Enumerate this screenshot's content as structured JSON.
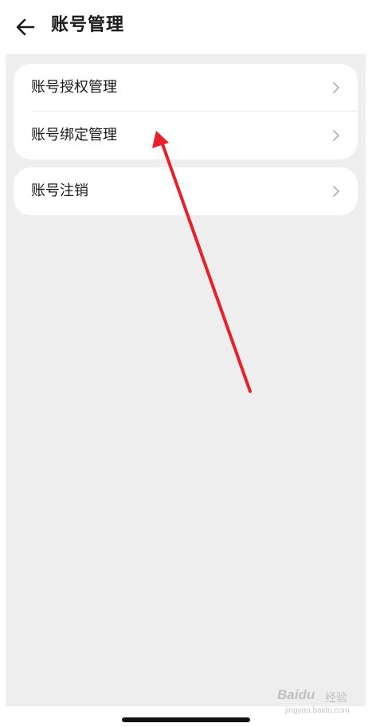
{
  "header": {
    "title": "账号管理",
    "back_icon": "arrow-left-icon"
  },
  "settings": {
    "group1": [
      {
        "label": "账号授权管理",
        "icon": "chevron-right-icon"
      },
      {
        "label": "账号绑定管理",
        "icon": "chevron-right-icon"
      }
    ],
    "group2": [
      {
        "label": "账号注销",
        "icon": "chevron-right-icon"
      }
    ]
  },
  "annotation": {
    "color": "#e8202a",
    "shape": "arrow"
  },
  "watermark": {
    "brand": "Baidu",
    "sub": "经验",
    "url": "jingyan.baidu.com"
  },
  "colors": {
    "background": "#eeeeee",
    "card": "#ffffff",
    "text": "#1a1a1a",
    "chevron": "#b0b0b0"
  }
}
